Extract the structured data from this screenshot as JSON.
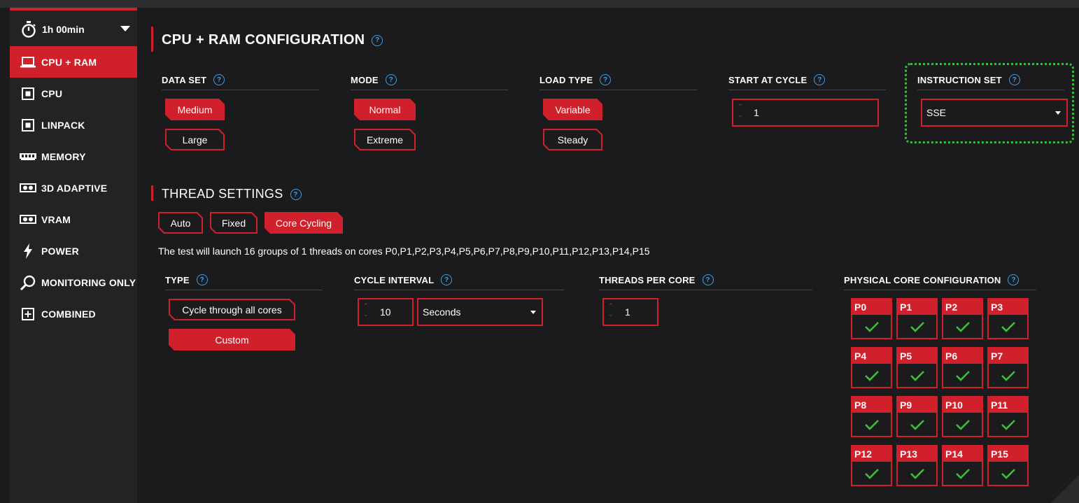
{
  "sidebar": {
    "timer": {
      "label": "1h 00min",
      "icon": "stopwatch-icon"
    },
    "items": [
      {
        "label": "CPU + RAM",
        "icon": "laptop-icon",
        "active": true
      },
      {
        "label": "CPU",
        "icon": "cpu-chip-icon",
        "active": false
      },
      {
        "label": "LINPACK",
        "icon": "cpu-chip-icon",
        "active": false
      },
      {
        "label": "MEMORY",
        "icon": "memory-stick-icon",
        "active": false
      },
      {
        "label": "3D ADAPTIVE",
        "icon": "gpu-card-icon",
        "active": false
      },
      {
        "label": "VRAM",
        "icon": "gpu-card-icon",
        "active": false
      },
      {
        "label": "POWER",
        "icon": "lightning-icon",
        "active": false
      },
      {
        "label": "MONITORING ONLY",
        "icon": "magnifier-icon",
        "active": false
      },
      {
        "label": "COMBINED",
        "icon": "plus-box-icon",
        "active": false
      }
    ]
  },
  "config": {
    "title": "CPU + RAM CONFIGURATION",
    "data_set": {
      "label": "DATA SET",
      "options": [
        "Medium",
        "Large"
      ],
      "selected": "Medium"
    },
    "mode": {
      "label": "MODE",
      "options": [
        "Normal",
        "Extreme"
      ],
      "selected": "Normal"
    },
    "load_type": {
      "label": "LOAD TYPE",
      "options": [
        "Variable",
        "Steady"
      ],
      "selected": "Variable"
    },
    "start_at_cycle": {
      "label": "START AT CYCLE",
      "value": "1"
    },
    "instruction_set": {
      "label": "INSTRUCTION SET",
      "value": "SSE"
    }
  },
  "threads": {
    "title": "THREAD SETTINGS",
    "modes": [
      "Auto",
      "Fixed",
      "Core Cycling"
    ],
    "selected": "Core Cycling",
    "description": "The test will launch 16 groups of 1 threads on cores P0,P1,P2,P3,P4,P5,P6,P7,P8,P9,P10,P11,P12,P13,P14,P15",
    "type": {
      "label": "TYPE",
      "options": [
        "Cycle through all cores",
        "Custom"
      ],
      "selected": "Custom"
    },
    "cycle_interval": {
      "label": "CYCLE INTERVAL",
      "value": "10",
      "unit": "Seconds"
    },
    "threads_per_core": {
      "label": "THREADS PER CORE",
      "value": "1"
    },
    "physical_cores": {
      "label": "PHYSICAL CORE CONFIGURATION",
      "cores": [
        "P0",
        "P1",
        "P2",
        "P3",
        "P4",
        "P5",
        "P6",
        "P7",
        "P8",
        "P9",
        "P10",
        "P11",
        "P12",
        "P13",
        "P14",
        "P15"
      ]
    }
  },
  "colors": {
    "accent": "#d0202c",
    "help": "#3aa0e8",
    "check": "#38c038",
    "highlight": "#22cc22"
  }
}
